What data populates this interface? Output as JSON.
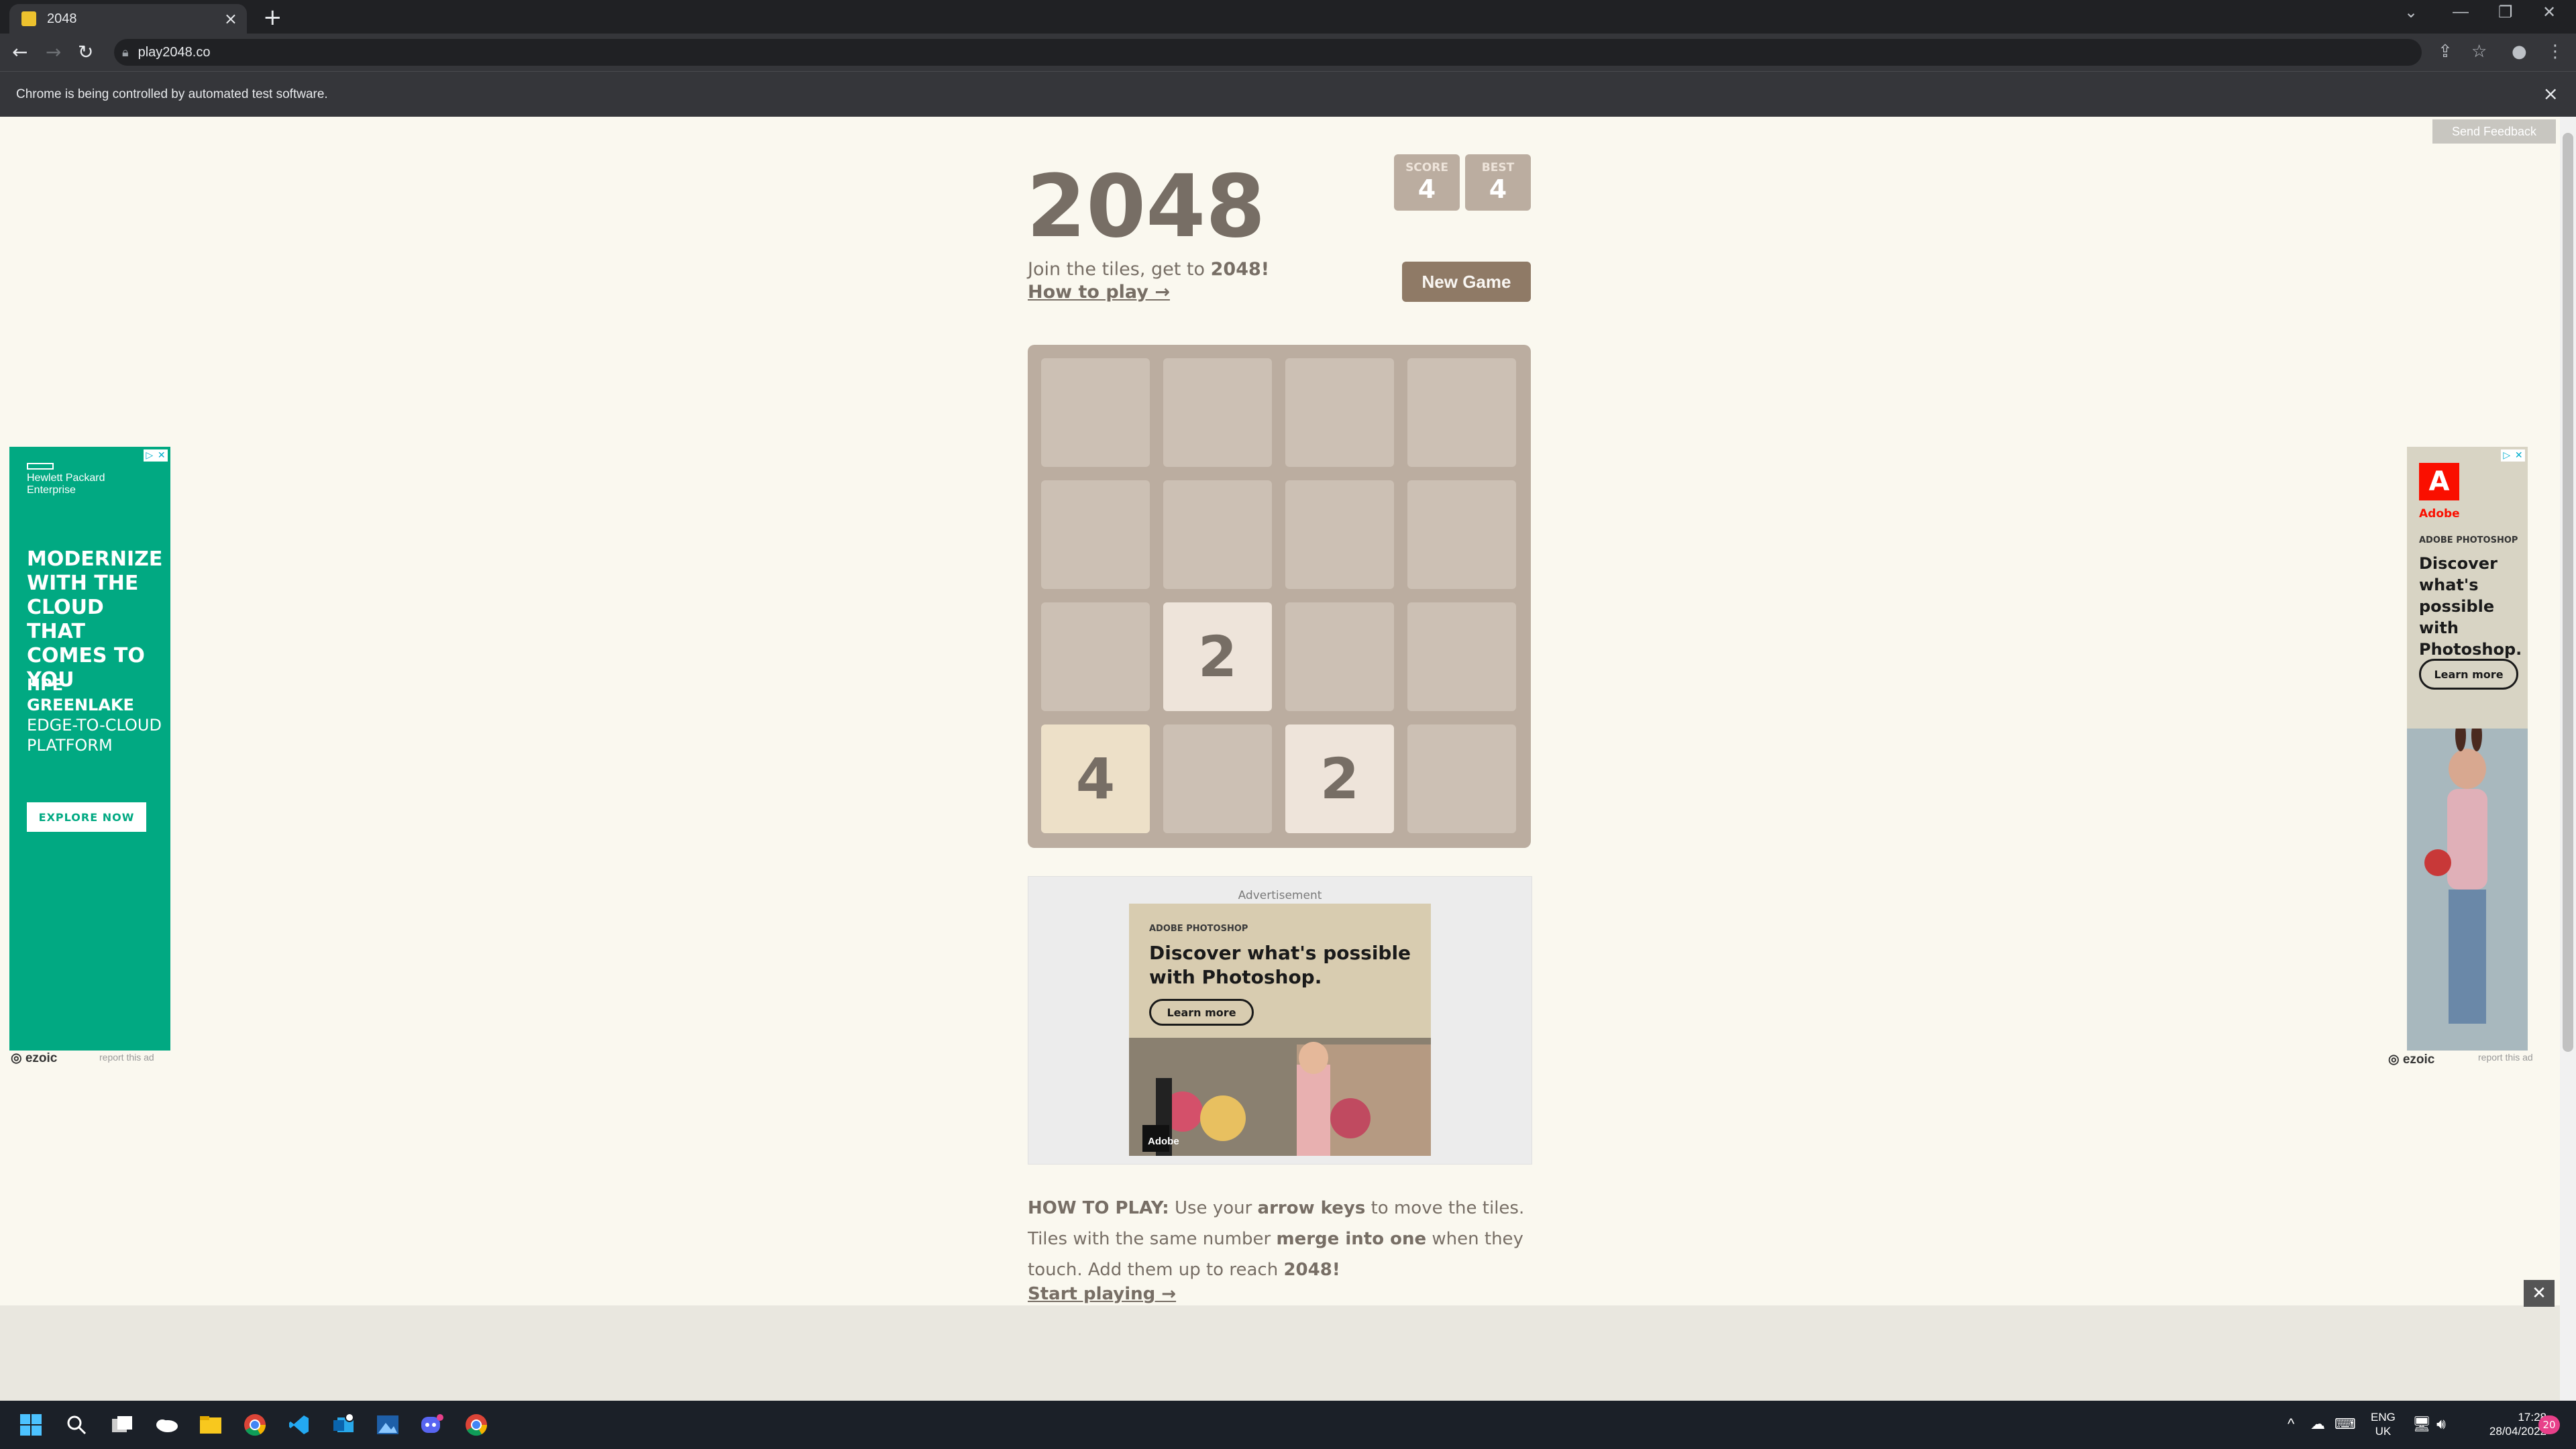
{
  "browser": {
    "tab_title": "2048",
    "url": "play2048.co",
    "infobar_message": "Chrome is being controlled by automated test software.",
    "colors": {
      "frame": "#202124",
      "toolbar": "#35363a"
    }
  },
  "page": {
    "send_feedback": "Send Feedback",
    "title": "2048",
    "score_label": "SCORE",
    "score_value": "4",
    "best_label": "BEST",
    "best_value": "4",
    "subtitle_prefix": "Join the tiles, get to ",
    "subtitle_bold": "2048!",
    "how_to_link": "How to play →",
    "new_game": "New Game",
    "board": [
      [
        "",
        "",
        "",
        ""
      ],
      [
        "",
        "",
        "",
        ""
      ],
      [
        "",
        "2",
        "",
        ""
      ],
      [
        "4",
        "",
        "2",
        ""
      ]
    ],
    "advertisement_label": "Advertisement",
    "how_to_play": {
      "label": "HOW TO PLAY:",
      "t1": " Use your ",
      "b1": "arrow keys",
      "t2": " to move the tiles. Tiles with the same number ",
      "b2": "merge into one",
      "t3": " when they touch. Add them up to reach ",
      "b3": "2048!"
    },
    "start_playing": "Start playing →",
    "colors": {
      "background": "#faf8ef",
      "board": "#bbada0",
      "text": "#776e65",
      "button": "#8f7a66"
    }
  },
  "ads": {
    "left": {
      "company_1": "Hewlett Packard",
      "company_2": "Enterprise",
      "headline": "MODERNIZE WITH THE CLOUD THAT COMES TO YOU",
      "sub_bold": "HPE GREENLAKE",
      "sub": "EDGE-TO-CLOUD PLATFORM",
      "button": "EXPLORE NOW",
      "ezoic": "ezoic",
      "report": "report this ad",
      "color": "#01a982"
    },
    "center": {
      "brand": "ADOBE PHOTOSHOP",
      "headline": "Discover what's possible with Photoshop.",
      "button": "Learn more",
      "logo_text": "Adobe"
    },
    "right": {
      "logo_text": "Adobe",
      "brand": "ADOBE PHOTOSHOP",
      "headline": "Discover what's possible with Photoshop.",
      "button": "Learn more",
      "ezoic": "ezoic",
      "report": "report this ad"
    }
  },
  "taskbar": {
    "lang_1": "ENG",
    "lang_2": "UK",
    "time": "17:28",
    "date": "28/04/2022",
    "notifications": "20",
    "icons": [
      "windows-start-icon",
      "search-icon",
      "task-view-icon",
      "onedrive-icon",
      "file-explorer-icon",
      "chrome-icon",
      "vscode-icon",
      "outlook-icon",
      "photos-icon",
      "discord-icon",
      "chrome-dev-icon"
    ]
  }
}
